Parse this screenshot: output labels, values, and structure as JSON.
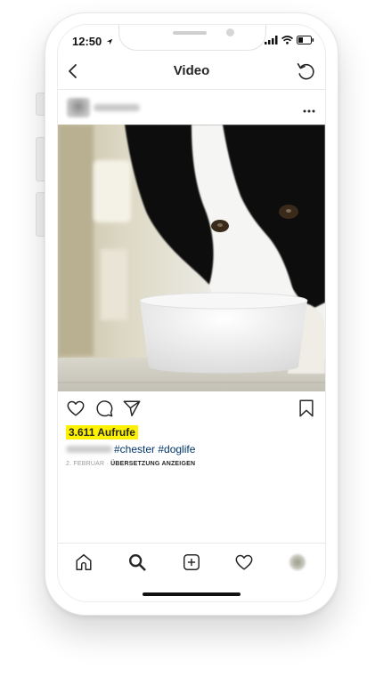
{
  "status_bar": {
    "time": "12:50"
  },
  "header": {
    "title": "Video"
  },
  "post": {
    "views": "3.611 Aufrufe",
    "caption_tags": "#chester #doglife",
    "date": "2. FEBRUAR",
    "separator": "·",
    "translate_label": "ÜBERSETZUNG ANZEIGEN"
  },
  "icons": {
    "status": [
      "location-arrow-icon",
      "signal-icon",
      "wifi-icon",
      "battery-icon"
    ],
    "header": [
      "back-chevron-icon",
      "refresh-icon"
    ],
    "post_header": [
      "more-options-icon"
    ],
    "actions": [
      "like-heart-icon",
      "comment-icon",
      "share-send-icon",
      "bookmark-icon"
    ],
    "bottom_nav": [
      "home-icon",
      "search-icon",
      "new-post-icon",
      "activity-heart-icon",
      "profile-avatar"
    ]
  },
  "colors": {
    "views_highlight": "#fff200",
    "hashtag": "#003569",
    "text": "#262626",
    "meta_gray": "#999999"
  }
}
